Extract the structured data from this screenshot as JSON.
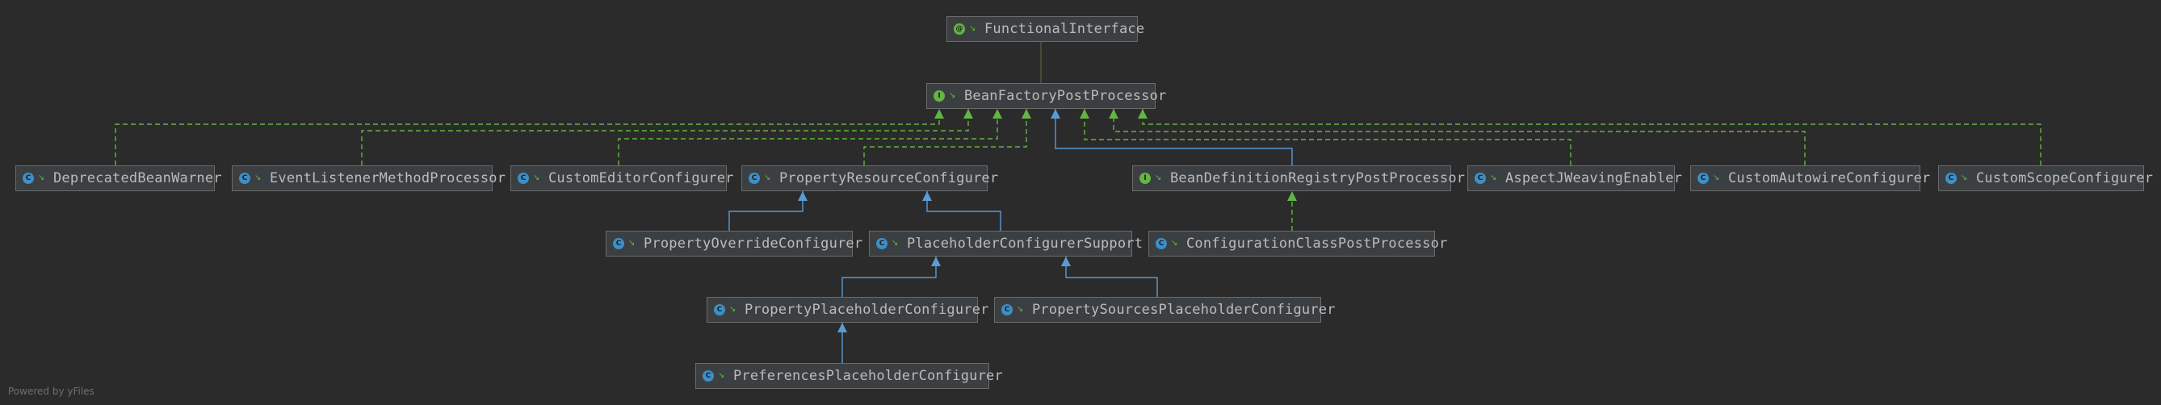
{
  "diagram": {
    "nodes": [
      {
        "id": "FunctionalInterface",
        "label": "FunctionalInterface",
        "kind": "annotation",
        "badge": "@",
        "color": "#62b543"
      },
      {
        "id": "BeanFactoryPostProcessor",
        "label": "BeanFactoryPostProcessor",
        "kind": "interface",
        "badge": "I",
        "color": "#62b543"
      },
      {
        "id": "DeprecatedBeanWarner",
        "label": "DeprecatedBeanWarner",
        "kind": "class",
        "badge": "C",
        "color": "#3d8fc7"
      },
      {
        "id": "EventListenerMethodProcessor",
        "label": "EventListenerMethodProcessor",
        "kind": "class",
        "badge": "C",
        "color": "#3d8fc7"
      },
      {
        "id": "CustomEditorConfigurer",
        "label": "CustomEditorConfigurer",
        "kind": "class",
        "badge": "C",
        "color": "#3d8fc7"
      },
      {
        "id": "PropertyResourceConfigurer",
        "label": "PropertyResourceConfigurer",
        "kind": "class",
        "badge": "C",
        "color": "#3d8fc7"
      },
      {
        "id": "BeanDefinitionRegistryPostProcessor",
        "label": "BeanDefinitionRegistryPostProcessor",
        "kind": "interface",
        "badge": "I",
        "color": "#62b543"
      },
      {
        "id": "AspectJWeavingEnabler",
        "label": "AspectJWeavingEnabler",
        "kind": "class",
        "badge": "C",
        "color": "#3d8fc7"
      },
      {
        "id": "CustomAutowireConfigurer",
        "label": "CustomAutowireConfigurer",
        "kind": "class",
        "badge": "C",
        "color": "#3d8fc7"
      },
      {
        "id": "CustomScopeConfigurer",
        "label": "CustomScopeConfigurer",
        "kind": "class",
        "badge": "C",
        "color": "#3d8fc7"
      },
      {
        "id": "PropertyOverrideConfigurer",
        "label": "PropertyOverrideConfigurer",
        "kind": "class",
        "badge": "C",
        "color": "#3d8fc7"
      },
      {
        "id": "PlaceholderConfigurerSupport",
        "label": "PlaceholderConfigurerSupport",
        "kind": "class",
        "badge": "C",
        "color": "#3d8fc7"
      },
      {
        "id": "ConfigurationClassPostProcessor",
        "label": "ConfigurationClassPostProcessor",
        "kind": "class",
        "badge": "C",
        "color": "#3d8fc7"
      },
      {
        "id": "PropertyPlaceholderConfigurer",
        "label": "PropertyPlaceholderConfigurer",
        "kind": "class",
        "badge": "C",
        "color": "#3d8fc7"
      },
      {
        "id": "PropertySourcesPlaceholderConfigurer",
        "label": "PropertySourcesPlaceholderConfigurer",
        "kind": "class",
        "badge": "C",
        "color": "#3d8fc7"
      },
      {
        "id": "PreferencesPlaceholderConfigurer",
        "label": "PreferencesPlaceholderConfigurer",
        "kind": "class",
        "badge": "C",
        "color": "#3d8fc7"
      }
    ],
    "edges": [
      {
        "from": "BeanFactoryPostProcessor",
        "to": "FunctionalInterface",
        "type": "annotated"
      },
      {
        "from": "DeprecatedBeanWarner",
        "to": "BeanFactoryPostProcessor",
        "type": "implements"
      },
      {
        "from": "EventListenerMethodProcessor",
        "to": "BeanFactoryPostProcessor",
        "type": "implements"
      },
      {
        "from": "CustomEditorConfigurer",
        "to": "BeanFactoryPostProcessor",
        "type": "implements"
      },
      {
        "from": "PropertyResourceConfigurer",
        "to": "BeanFactoryPostProcessor",
        "type": "implements"
      },
      {
        "from": "BeanDefinitionRegistryPostProcessor",
        "to": "BeanFactoryPostProcessor",
        "type": "extends"
      },
      {
        "from": "AspectJWeavingEnabler",
        "to": "BeanFactoryPostProcessor",
        "type": "implements"
      },
      {
        "from": "CustomAutowireConfigurer",
        "to": "BeanFactoryPostProcessor",
        "type": "implements"
      },
      {
        "from": "CustomScopeConfigurer",
        "to": "BeanFactoryPostProcessor",
        "type": "implements"
      },
      {
        "from": "PropertyOverrideConfigurer",
        "to": "PropertyResourceConfigurer",
        "type": "extends"
      },
      {
        "from": "PlaceholderConfigurerSupport",
        "to": "PropertyResourceConfigurer",
        "type": "extends"
      },
      {
        "from": "ConfigurationClassPostProcessor",
        "to": "BeanDefinitionRegistryPostProcessor",
        "type": "implements"
      },
      {
        "from": "PropertyPlaceholderConfigurer",
        "to": "PlaceholderConfigurerSupport",
        "type": "extends"
      },
      {
        "from": "PropertySourcesPlaceholderConfigurer",
        "to": "PlaceholderConfigurerSupport",
        "type": "extends"
      },
      {
        "from": "PreferencesPlaceholderConfigurer",
        "to": "PropertyPlaceholderConfigurer",
        "type": "extends"
      }
    ],
    "colors": {
      "background": "#2b2b2b",
      "node_fill": "#3c3f41",
      "node_border": "#6b6b6b",
      "node_text": "#bbbbbb",
      "extends_edge": "#5a9bd5",
      "implements_edge": "#62b543",
      "annotated_edge": "#4e5a3e"
    }
  },
  "footer": {
    "text": "Powered by yFiles"
  }
}
